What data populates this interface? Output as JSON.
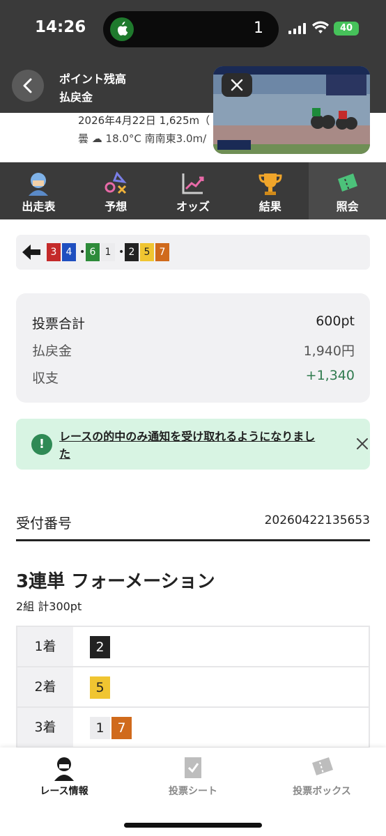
{
  "status_bar": {
    "time": "14:26",
    "island_count": "1",
    "battery": "40"
  },
  "header": {
    "title": "ポイント残高",
    "subtitle": "払戻金"
  },
  "race": {
    "date_line": "2026年4月22日 1,625m（",
    "weather_line": "曇 ☁ 18.0°C 南南東3.0m/"
  },
  "tabs": [
    {
      "label": "出走表",
      "icon": "racer-icon"
    },
    {
      "label": "予想",
      "icon": "prediction-icon"
    },
    {
      "label": "オッズ",
      "icon": "odds-chart-icon"
    },
    {
      "label": "結果",
      "icon": "trophy-icon"
    },
    {
      "label": "照会",
      "icon": "ticket-icon",
      "active": true
    }
  ],
  "combo": {
    "groups": [
      [
        "3",
        "4"
      ],
      [
        "6",
        "1"
      ],
      [
        "2",
        "5",
        "7"
      ]
    ],
    "colors": {
      "1": "#ececee",
      "2": "#222222",
      "3": "#c42a2a",
      "4": "#1f4fc0",
      "5": "#f0c531",
      "6": "#2e8b3a",
      "7": "#d06a1c"
    }
  },
  "summary": {
    "total_label": "投票合計",
    "total_value": "600pt",
    "payout_label": "払戻金",
    "payout_value": "1,940円",
    "balance_label": "収支",
    "balance_value": "+1,340"
  },
  "notice": {
    "text": "レースの的中のみ通知を受け取れるようになりました"
  },
  "reception": {
    "label": "受付番号",
    "value": "20260422135653"
  },
  "bet": {
    "type": "3連単 フォーメーション",
    "count": "2組 計300pt",
    "places": [
      {
        "label": "1着",
        "numbers": [
          "2"
        ]
      },
      {
        "label": "2着",
        "numbers": [
          "5"
        ]
      },
      {
        "label": "3着",
        "numbers": [
          "1",
          "7"
        ]
      }
    ]
  },
  "bottom_nav": [
    {
      "label": "レース情報",
      "active": true
    },
    {
      "label": "投票シート"
    },
    {
      "label": "投票ボックス"
    }
  ]
}
